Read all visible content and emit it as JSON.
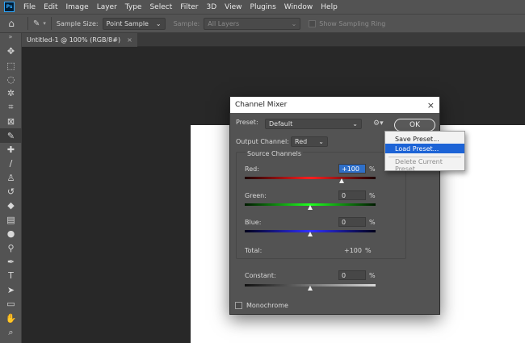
{
  "app": {
    "logo": "Ps"
  },
  "menu": [
    "File",
    "Edit",
    "Image",
    "Layer",
    "Type",
    "Select",
    "Filter",
    "3D",
    "View",
    "Plugins",
    "Window",
    "Help"
  ],
  "options_bar": {
    "sample_size_label": "Sample Size:",
    "sample_size_value": "Point Sample",
    "sample_label": "Sample:",
    "sample_value": "All Layers",
    "sampling_ring_label": "Show Sampling Ring"
  },
  "document_tab": {
    "title": "Untitled-1 @ 100% (RGB/8#)",
    "close": "×"
  },
  "tools": [
    "move-icon",
    "marquee-icon",
    "lasso-icon",
    "magic-wand-icon",
    "crop-icon",
    "frame-icon",
    "eyedropper-icon",
    "healing-icon",
    "brush-icon",
    "stamp-icon",
    "history-brush-icon",
    "eraser-icon",
    "gradient-icon",
    "blur-icon",
    "dodge-icon",
    "pen-icon",
    "type-icon",
    "path-select-icon",
    "shape-icon",
    "hand-icon",
    "zoom-icon"
  ],
  "dialog": {
    "title": "Channel Mixer",
    "close": "×",
    "preset_label": "Preset:",
    "preset_value": "Default",
    "ok_label": "OK",
    "output_label": "Output Channel:",
    "output_value": "Red",
    "source_title": "Source Channels",
    "red_label": "Red:",
    "red_value": "+100",
    "green_label": "Green:",
    "green_value": "0",
    "blue_label": "Blue:",
    "blue_value": "0",
    "percent": "%",
    "total_label": "Total:",
    "total_value": "+100",
    "constant_label": "Constant:",
    "constant_value": "0",
    "monochrome_label": "Monochrome"
  },
  "preset_menu": {
    "save": "Save Preset...",
    "load": "Load Preset...",
    "delete": "Delete Current Preset"
  },
  "colors": {
    "accent": "#1c63d6",
    "bg": "#282828",
    "panel": "#535353"
  }
}
